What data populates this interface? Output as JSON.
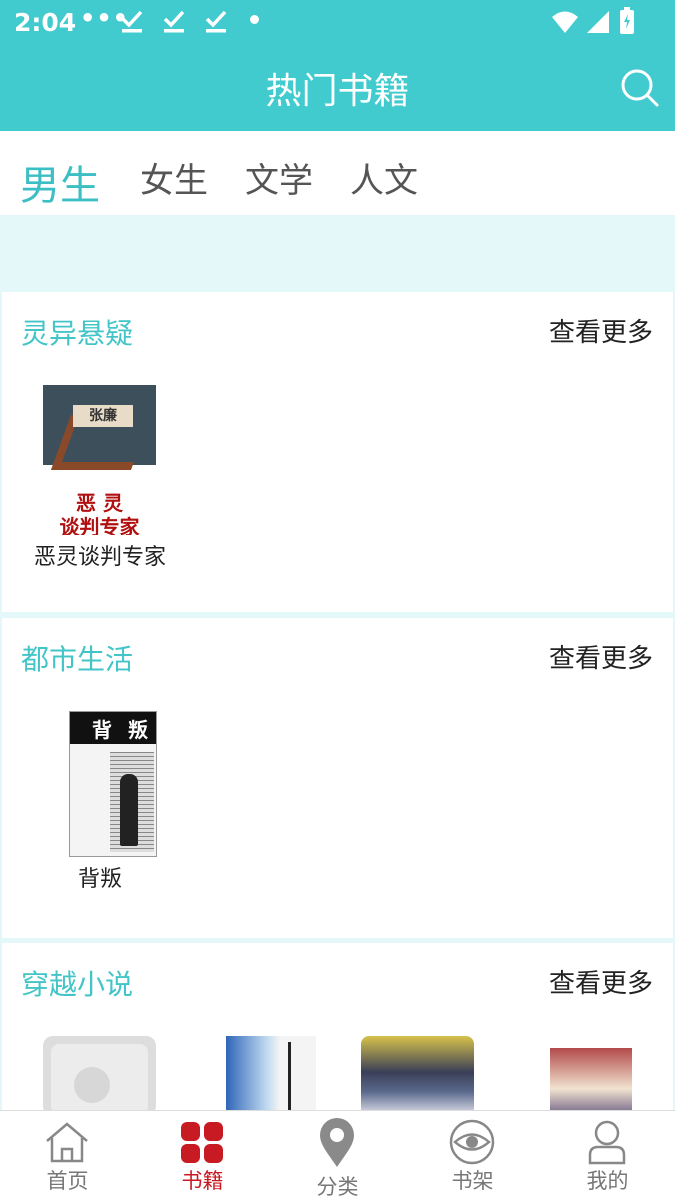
{
  "status_bar": {
    "time": "2:04",
    "dots": "•••"
  },
  "header": {
    "title": "热门书籍"
  },
  "tabs": [
    {
      "label": "男生",
      "active": true
    },
    {
      "label": "女生",
      "active": false
    },
    {
      "label": "文学",
      "active": false
    },
    {
      "label": "人文",
      "active": false
    }
  ],
  "sections": [
    {
      "title": "灵异悬疑",
      "more": "查看更多",
      "books": [
        {
          "title": "恶灵谈判专家",
          "cover_text": [
            "张廉",
            "恶 灵",
            "谈判专家"
          ]
        }
      ]
    },
    {
      "title": "都市生活",
      "more": "查看更多",
      "books": [
        {
          "title": "背叛",
          "cover_text": [
            "背",
            "叛"
          ]
        }
      ]
    },
    {
      "title": "穿越小说",
      "more": "查看更多",
      "books": [
        {
          "title": ""
        },
        {
          "title": ""
        },
        {
          "title": ""
        },
        {
          "title": ""
        }
      ]
    }
  ],
  "bottom_nav": [
    {
      "label": "首页",
      "icon": "home-icon",
      "active": false
    },
    {
      "label": "书籍",
      "icon": "grid-icon",
      "active": true
    },
    {
      "label": "分类",
      "icon": "location-pin-icon",
      "active": false
    },
    {
      "label": "书架",
      "icon": "eye-icon",
      "active": false
    },
    {
      "label": "我的",
      "icon": "person-icon",
      "active": false
    }
  ],
  "colors": {
    "accent": "#42cbcf",
    "nav_active": "#c81a22",
    "page_bg": "#e4f8fa"
  }
}
